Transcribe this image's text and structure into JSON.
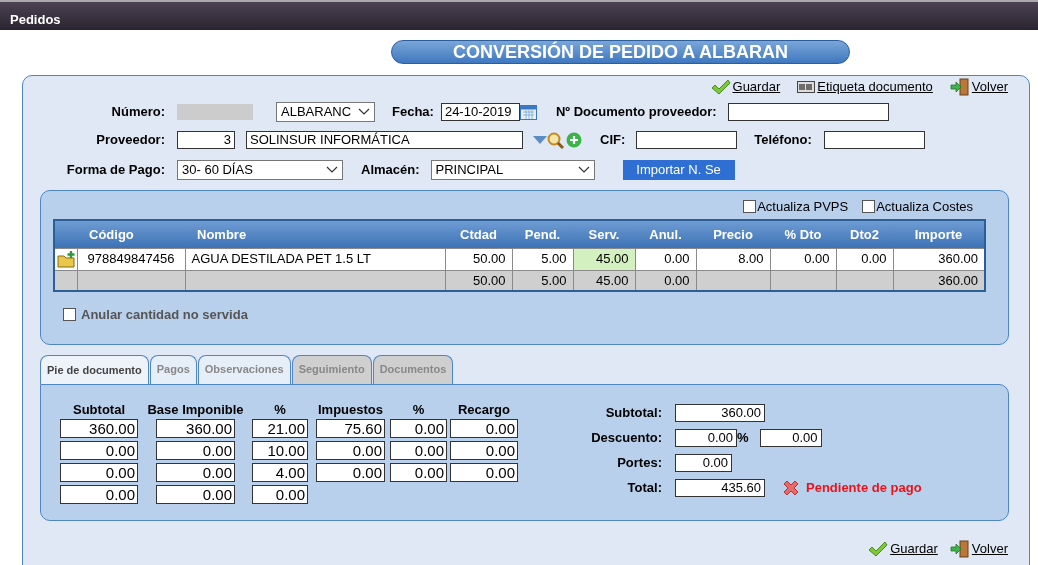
{
  "window": {
    "title": "Pedidos"
  },
  "heading": "CONVERSIÓN DE PEDIDO A ALBARAN",
  "top_actions": [
    {
      "kind": "save",
      "label": "Guardar"
    },
    {
      "kind": "label",
      "label": "Etiqueta documento"
    },
    {
      "kind": "back",
      "label": "Volver"
    }
  ],
  "form": {
    "numero_label": "Número:",
    "serie": "ALBARANC",
    "fecha_label": "Fecha:",
    "fecha": "24-10-2019",
    "doc_label": "Nº Documento proveedor:",
    "proveedor_label": "Proveedor:",
    "proveedor_code": "3",
    "proveedor_name": "SOLINSUR INFORMÁTICA",
    "cif_label": "CIF:",
    "telefono_label": "Teléfono:",
    "pago_label": "Forma de Pago:",
    "pago": "30- 60 DÍAS",
    "almacen_label": "Almacén:",
    "almacen": "PRINCIPAL",
    "import_button": "Importar N. Se"
  },
  "options": [
    {
      "label": "Actualiza PVPS",
      "checked": false
    },
    {
      "label": "Actualiza Costes",
      "checked": false
    }
  ],
  "table": {
    "columns": [
      "Código",
      "Nombre",
      "Ctdad",
      "Pend.",
      "Serv.",
      "Anul.",
      "Precio",
      "% Dto",
      "Dto2",
      "Importe"
    ],
    "rows": [
      {
        "cells": [
          {
            "text": "978849847456",
            "highlighted": false
          },
          {
            "text": "AGUA DESTILADA PET 1.5 LT",
            "highlighted": false
          },
          {
            "text": "50.00",
            "highlighted": false
          },
          {
            "text": "5.00",
            "highlighted": false
          },
          {
            "text": "45.00",
            "highlighted": true
          },
          {
            "text": "0.00",
            "highlighted": false
          },
          {
            "text": "8.00",
            "highlighted": false
          },
          {
            "text": "0.00",
            "highlighted": false
          },
          {
            "text": "0.00",
            "highlighted": false
          },
          {
            "text": "360.00",
            "highlighted": false
          }
        ]
      }
    ],
    "totals": {
      "ctdad": "50.00",
      "pend": "5.00",
      "serv": "45.00",
      "anul": "0.00",
      "importe": "360.00"
    }
  },
  "anular": {
    "label": "Anular cantidad no servida",
    "checked": false
  },
  "tabs": [
    {
      "label": "Pie de documento",
      "selected": true,
      "disabled": false
    },
    {
      "label": "Pagos",
      "selected": false,
      "disabled": false
    },
    {
      "label": "Observaciones",
      "selected": false,
      "disabled": false
    },
    {
      "label": "Seguimiento",
      "selected": false,
      "disabled": true
    },
    {
      "label": "Documentos",
      "selected": false,
      "disabled": true
    }
  ],
  "tax_table": {
    "columns": [
      "Subtotal",
      "Base Imponible",
      "%",
      "Impuestos",
      "%",
      "Recargo"
    ],
    "rows": [
      [
        "360.00",
        "360.00",
        "21.00",
        "75.60",
        "0.00",
        "0.00"
      ],
      [
        "0.00",
        "0.00",
        "10.00",
        "0.00",
        "0.00",
        "0.00"
      ],
      [
        "0.00",
        "0.00",
        "4.00",
        "0.00",
        "0.00",
        "0.00"
      ],
      [
        "0.00",
        "0.00",
        "0.00"
      ]
    ]
  },
  "summary": {
    "subtotal_label": "Subtotal:",
    "subtotal": "360.00",
    "descuento_label": "Descuento:",
    "descuento_pct": "0.00",
    "pct_sign": "%",
    "descuento_amount": "0.00",
    "portes_label": "Portes:",
    "portes": "0.00",
    "total_label": "Total:",
    "total": "435.60",
    "status": "Pendiente de pago"
  },
  "bottom_actions": [
    {
      "kind": "save",
      "label": "Guardar"
    },
    {
      "kind": "back",
      "label": "Volver"
    }
  ]
}
